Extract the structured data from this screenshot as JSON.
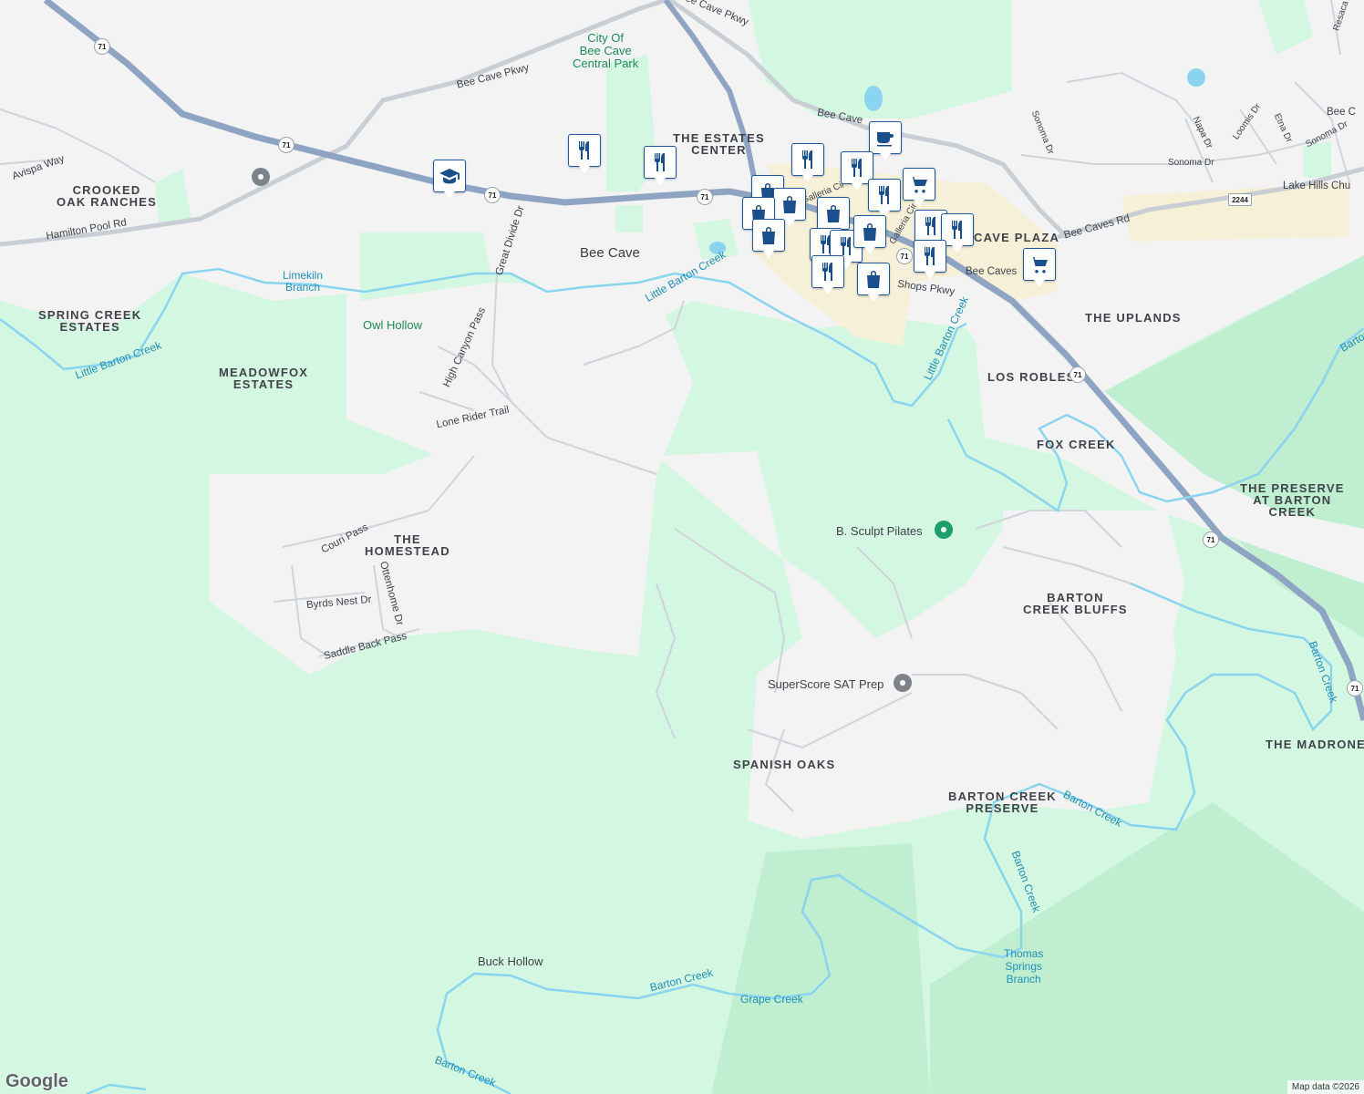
{
  "areas": [
    {
      "text": "CROOKED\nOAK RANCHES"
    },
    {
      "text": "SPRING CREEK\nESTATES"
    },
    {
      "text": "MEADOWFOX\nESTATES"
    },
    {
      "text": "THE\nHOMESTEAD"
    },
    {
      "text": "THE ESTATES\nCENTER"
    },
    {
      "text": "CAVE PLAZA"
    },
    {
      "text": "THE UPLANDS"
    },
    {
      "text": "LOS ROBLES"
    },
    {
      "text": "FOX CREEK"
    },
    {
      "text": "THE PRESERVE\nAT BARTON\nCREEK"
    },
    {
      "text": "BARTON\nCREEK BLUFFS"
    },
    {
      "text": "SPANISH OAKS"
    },
    {
      "text": "BARTON CREEK\nPRESERVE"
    },
    {
      "text": "THE MADRONES"
    }
  ],
  "city": "Bee Cave",
  "parks": [
    "City Of\nBee Cave\nCentral Park",
    "Owl Hollow",
    "Buck Hollow"
  ],
  "roads": [
    "Bee Cave Pkwy",
    "Bee Cave Pkwy",
    "Bee Cave",
    "Avispa Way",
    "Hamilton Pool Rd",
    "Great Divide Dr",
    "High Canyon Pass",
    "Lone Rider Trail",
    "Couri Pass",
    "Byrds Nest Dr",
    "Ottenhome Dr",
    "Saddle Back Pass",
    "Bee Caves Rd",
    "Bee Caves",
    "Shops Pkwy",
    "Galleria Cir",
    "Galleria Cir",
    "Sonoma Dr",
    "Sonoma Dr",
    "Sonoma Dr",
    "Napa Dr",
    "Loomis Dr",
    "Etna Dr",
    "Bee C",
    "Resaca",
    "Lake Hills Chu"
  ],
  "waters": [
    "Limekiln\nBranch",
    "Little Barton Creek",
    "Little Barton Creek",
    "Little Barton Creek",
    "Barton Creek",
    "Barton Creek",
    "Barton Creek",
    "Barton Creek",
    "Barton Creek",
    "Thomas\nSprings\nBranch",
    "Grape Creek"
  ],
  "pois": [
    "B. Sculpt Pilates",
    "SuperScore SAT Prep"
  ],
  "shields": [
    "71",
    "71",
    "71",
    "71",
    "71",
    "71",
    "71",
    "71",
    "2244"
  ],
  "pins": [
    "restaurant",
    "restaurant",
    "restaurant",
    "coffee",
    "restaurant",
    "shopping",
    "shopping",
    "restaurant",
    "shopping",
    "restaurant",
    "restaurant",
    "shopping",
    "restaurant",
    "restaurant",
    "restaurant",
    "shopping",
    "grocery",
    "restaurant",
    "restaurant",
    "restaurant",
    "shopping",
    "grocery",
    "school"
  ],
  "colors": {
    "land": "#f3f3f4",
    "park": "#d4f7e2",
    "park_dark": "#bfeed1",
    "commercial": "#f6f0d9",
    "highway": "#8fa4c2",
    "water": "#8ad4f0",
    "road": "#cfd4da",
    "pin_border": "#1f5a9e",
    "pin_icon": "#1a4f8b",
    "poi_green": "#1e9e6a",
    "poi_gray": "#7d8389"
  },
  "attribution": "Map data ©2026",
  "logo": "Google"
}
